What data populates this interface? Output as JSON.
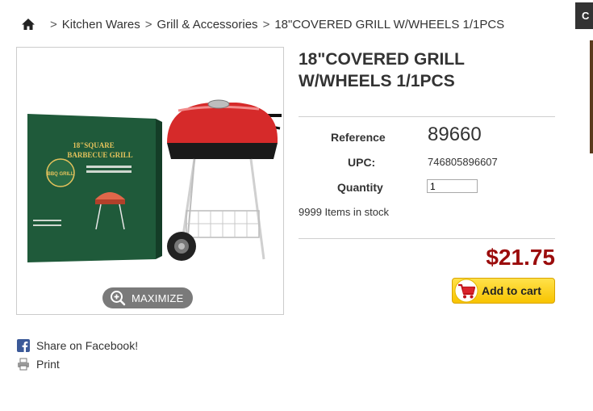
{
  "breadcrumb": {
    "items": [
      {
        "label": "Kitchen Wares"
      },
      {
        "label": "Grill & Accessories"
      },
      {
        "label": "18\"COVERED GRILL W/WHEELS 1/1PCS"
      }
    ],
    "separator": ">"
  },
  "gallery": {
    "maximize_label": "MAXIMIZE",
    "box_art": {
      "heading_line1": "18\"SQUARE",
      "heading_line2": "BARBECUE GRILL",
      "badge_text": "BBQ GRILL"
    }
  },
  "product": {
    "title": "18\"COVERED GRILL W/WHEELS 1/1PCS",
    "reference_label": "Reference",
    "reference_value": "89660",
    "upc_label": "UPC:",
    "upc_value": "746805896607",
    "quantity_label": "Quantity",
    "quantity_value": "1",
    "stock_text": "9999 Items in stock",
    "price": "$21.75",
    "add_to_cart_label": "Add to cart"
  },
  "share": {
    "facebook_label": "Share on Facebook!",
    "print_label": "Print"
  },
  "side_tab_label": "C",
  "colors": {
    "price": "#9b0c0c",
    "cart_button": "#f8c400",
    "grill_red": "#d62a2a",
    "box_green": "#1f5a3a",
    "facebook_blue": "#3b5998"
  }
}
